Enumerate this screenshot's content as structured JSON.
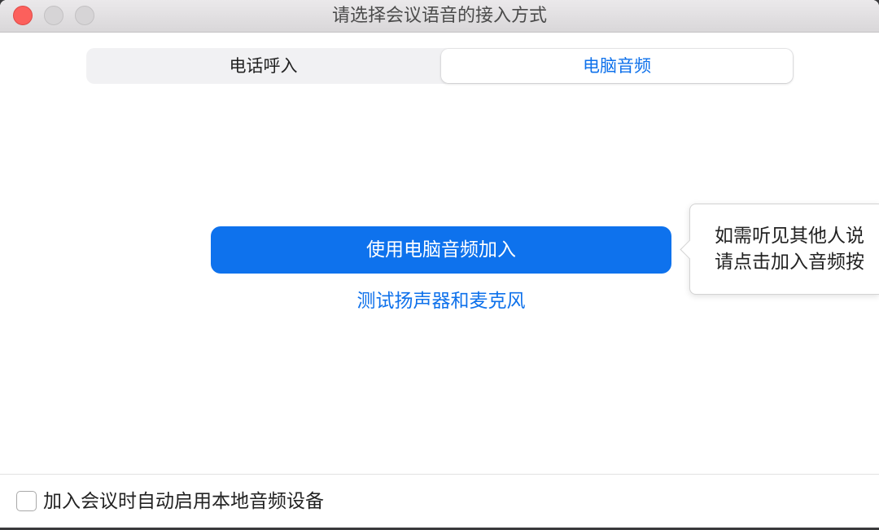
{
  "window": {
    "title": "请选择会议语音的接入方式",
    "controls": [
      "close-icon",
      "minimize-icon",
      "zoom-icon"
    ]
  },
  "tabs": {
    "items": [
      {
        "label": "电话呼入",
        "selected": false
      },
      {
        "label": "电脑音频",
        "selected": true
      }
    ]
  },
  "main": {
    "join_button_label": "使用电脑音频加入",
    "test_link_label": "测试扬声器和麦克风"
  },
  "tooltip": {
    "lines": [
      "如需听见其他人说",
      "请点击加入音频按"
    ]
  },
  "footer": {
    "auto_join_label": "加入会议时自动启用本地音频设备",
    "auto_join_checked": false
  },
  "colors": {
    "accent": "#0e72ed",
    "close_control": "#fc605c",
    "inactive_control": "#d6d4d6"
  }
}
